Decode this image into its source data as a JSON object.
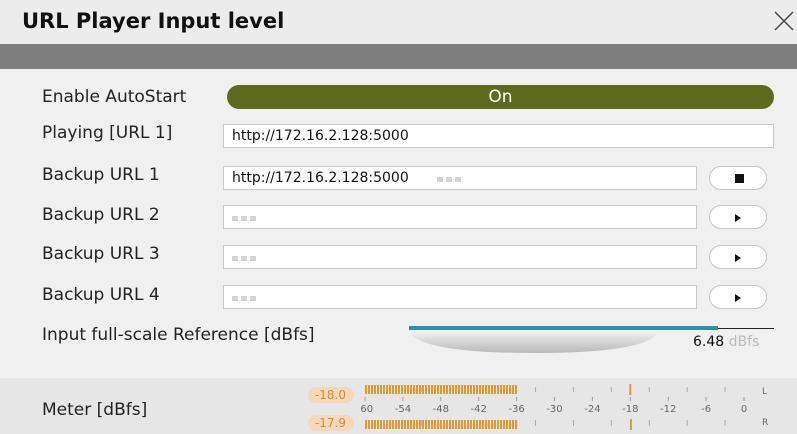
{
  "window": {
    "title": "URL Player Input level"
  },
  "autostart": {
    "label": "Enable AutoStart",
    "state": "On"
  },
  "playing": {
    "label": "Playing [URL 1]",
    "value": "http://172.16.2.128:5000"
  },
  "backups": [
    {
      "label": "Backup URL 1",
      "value": "http://172.16.2.128:5000",
      "button": "stop"
    },
    {
      "label": "Backup URL 2",
      "value": "",
      "button": "play"
    },
    {
      "label": "Backup URL 3",
      "value": "",
      "button": "play"
    },
    {
      "label": "Backup URL 4",
      "value": "",
      "button": "play"
    }
  ],
  "reference": {
    "label": "Input full-scale Reference [dBfs]",
    "value": "6.48",
    "unit": "dBfs"
  },
  "meter": {
    "label": "Meter [dBfs]",
    "peak_l": "-18.0",
    "peak_r": "-17.9",
    "scale": [
      "-60",
      "-54",
      "-48",
      "-42",
      "-36",
      "-30",
      "-24",
      "-18",
      "-12",
      "-6",
      "0"
    ],
    "level_l": -36,
    "level_r": -36,
    "channel_l": "L",
    "channel_r": "R"
  },
  "colors": {
    "toggle_on": "#5e6b1f",
    "ref_bar": "#2f8fa8",
    "meter": "#e0982f",
    "title_band": "#7f7f7f"
  }
}
